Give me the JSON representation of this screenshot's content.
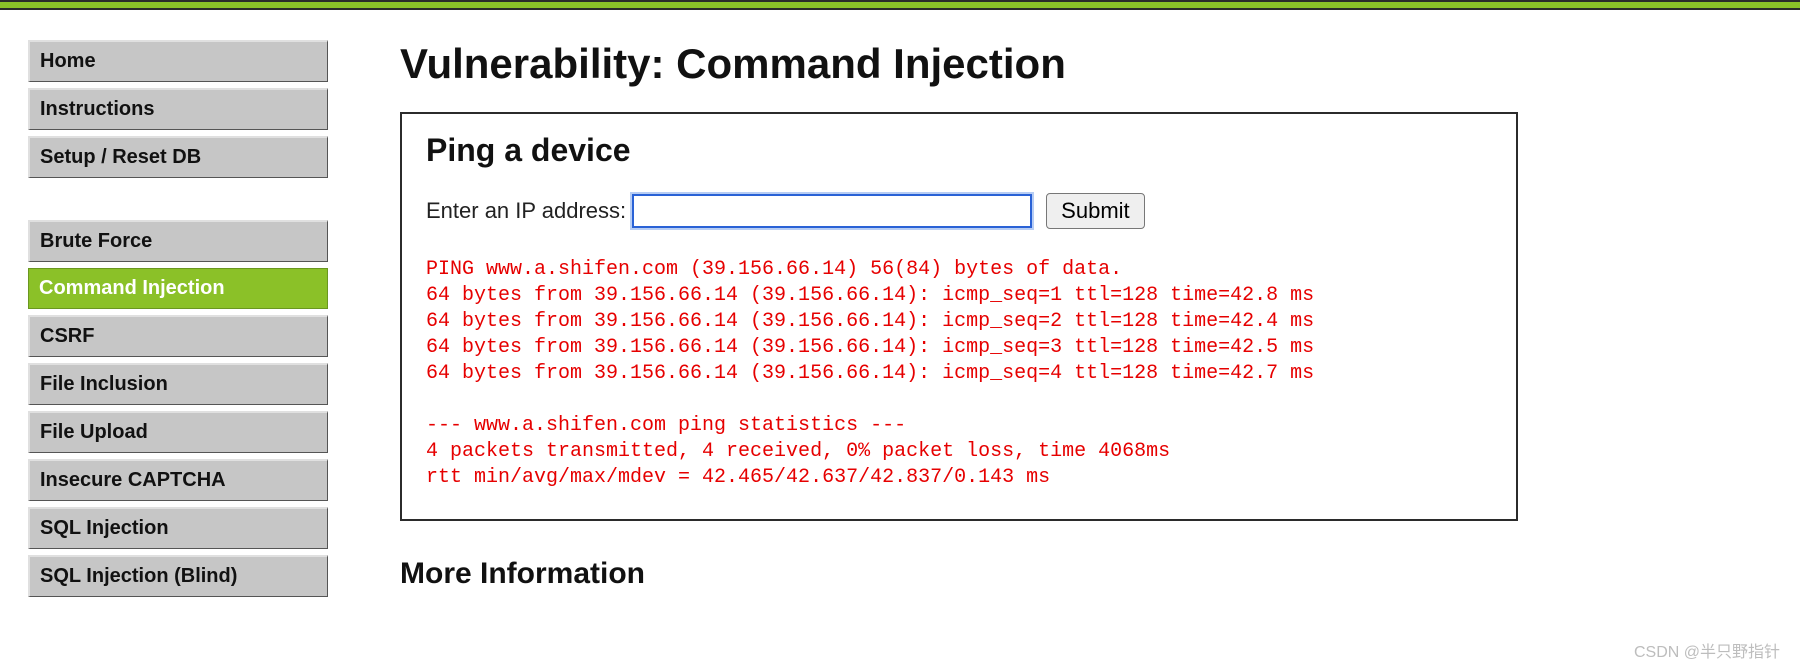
{
  "page": {
    "title": "Vulnerability: Command Injection",
    "panel_title": "Ping a device",
    "form_label": "Enter an IP address:",
    "submit_label": "Submit",
    "more_info": "More Information",
    "output": "PING www.a.shifen.com (39.156.66.14) 56(84) bytes of data.\n64 bytes from 39.156.66.14 (39.156.66.14): icmp_seq=1 ttl=128 time=42.8 ms\n64 bytes from 39.156.66.14 (39.156.66.14): icmp_seq=2 ttl=128 time=42.4 ms\n64 bytes from 39.156.66.14 (39.156.66.14): icmp_seq=3 ttl=128 time=42.5 ms\n64 bytes from 39.156.66.14 (39.156.66.14): icmp_seq=4 ttl=128 time=42.7 ms\n\n--- www.a.shifen.com ping statistics ---\n4 packets transmitted, 4 received, 0% packet loss, time 4068ms\nrtt min/avg/max/mdev = 42.465/42.637/42.837/0.143 ms"
  },
  "sidebar": {
    "groups": [
      [
        {
          "label": "Home",
          "active": false
        },
        {
          "label": "Instructions",
          "active": false
        },
        {
          "label": "Setup / Reset DB",
          "active": false
        }
      ],
      [
        {
          "label": "Brute Force",
          "active": false
        },
        {
          "label": "Command Injection",
          "active": true
        },
        {
          "label": "CSRF",
          "active": false
        },
        {
          "label": "File Inclusion",
          "active": false
        },
        {
          "label": "File Upload",
          "active": false
        },
        {
          "label": "Insecure CAPTCHA",
          "active": false
        },
        {
          "label": "SQL Injection",
          "active": false
        },
        {
          "label": "SQL Injection (Blind)",
          "active": false
        }
      ]
    ]
  },
  "watermark": "CSDN @半只野指针"
}
